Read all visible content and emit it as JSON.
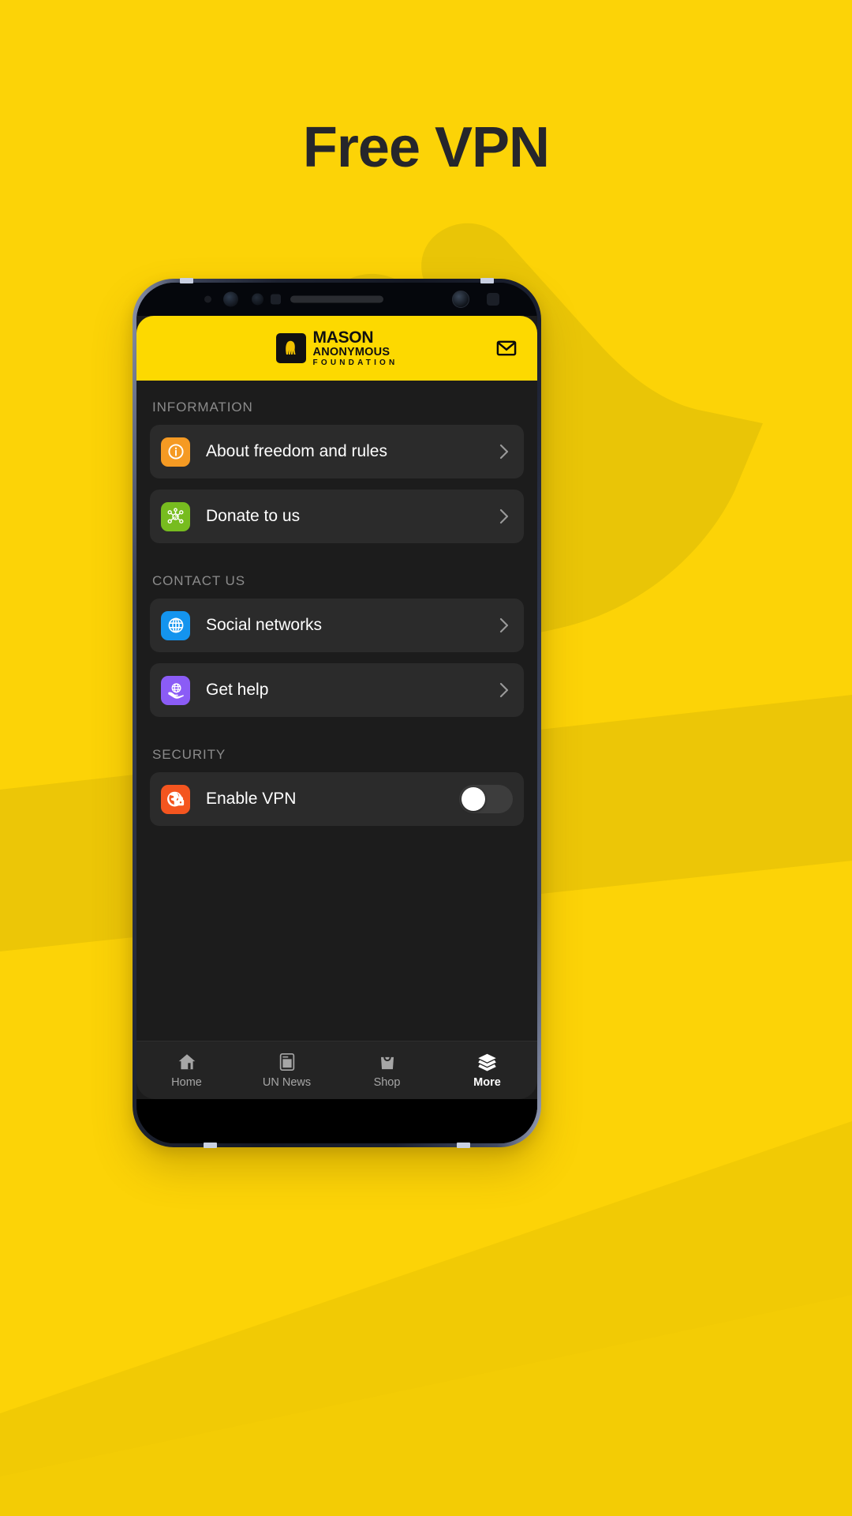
{
  "promo": {
    "title": "Free VPN",
    "background_color": "#FCD307",
    "title_color": "#26262B",
    "accent_band_color": "#EAC200"
  },
  "app": {
    "header": {
      "brand_line1": "MASON",
      "brand_line2": "ANONYMOUS",
      "brand_line3": "FOUNDATION",
      "brand_mark_icon": "hooded-hand-logo-icon",
      "background_color": "#FDD900",
      "mail_icon": "mail-icon"
    },
    "sections": [
      {
        "title": "INFORMATION",
        "items": [
          {
            "label": "About freedom and rules",
            "icon": "info-circle-icon",
            "icon_color": "#F59A23",
            "accessory": "chevron-right-icon"
          },
          {
            "label": "Donate to us",
            "icon": "donation-network-icon",
            "icon_color": "#77BC1F",
            "accessory": "chevron-right-icon"
          }
        ]
      },
      {
        "title": "CONTACT US",
        "items": [
          {
            "label": "Social networks",
            "icon": "globe-icon",
            "icon_color": "#1494EE",
            "accessory": "chevron-right-icon"
          },
          {
            "label": "Get help",
            "icon": "globe-in-hand-icon",
            "icon_color": "#8B5CF6",
            "accessory": "chevron-right-icon"
          }
        ]
      },
      {
        "title": "SECURITY",
        "items": [
          {
            "label": "Enable VPN",
            "icon": "globe-lock-icon",
            "icon_color": "#F4551F",
            "accessory": "toggle-switch",
            "toggle_state": "off"
          }
        ]
      }
    ],
    "tabbar": {
      "tabs": [
        {
          "label": "Home",
          "icon": "home-icon",
          "active": false
        },
        {
          "label": "UN News",
          "icon": "news-icon",
          "active": false
        },
        {
          "label": "Shop",
          "icon": "shopping-bag-icon",
          "active": false
        },
        {
          "label": "More",
          "icon": "layers-icon",
          "active": true
        }
      ],
      "active_color": "#FFFFFF",
      "inactive_color": "#A6A6A6"
    }
  }
}
